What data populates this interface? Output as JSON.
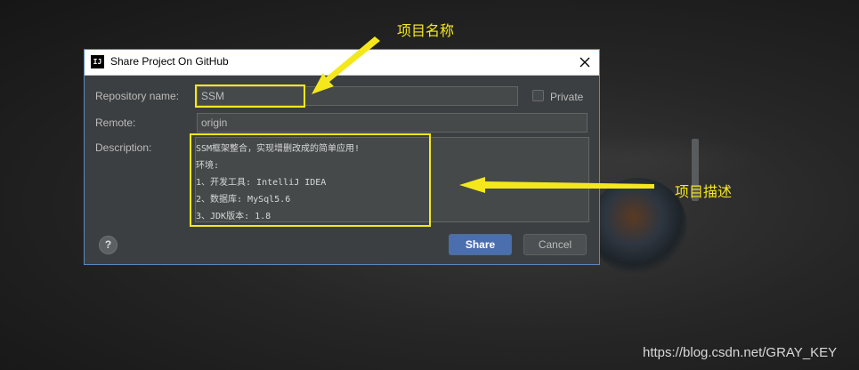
{
  "window": {
    "title": "Share Project On GitHub",
    "app_icon_text": "IJ"
  },
  "form": {
    "repository_label": "Repository name:",
    "repository_value": "SSM",
    "private_label": "Private",
    "private_checked": false,
    "remote_label": "Remote:",
    "remote_value": "origin",
    "description_label": "Description:",
    "description_lines": [
      "SSM框架整合，实现增删改成的简单应用!",
      "环境:",
      "1、开发工具: IntelliJ IDEA",
      "2、数据库: MySql5.6",
      "3、JDK版本: 1.8"
    ]
  },
  "buttons": {
    "help": "?",
    "share": "Share",
    "cancel": "Cancel"
  },
  "annotations": {
    "project_name": "项目名称",
    "project_description": "项目描述",
    "color": "#f4e81d"
  },
  "watermark": "https://blog.csdn.net/GRAY_KEY"
}
